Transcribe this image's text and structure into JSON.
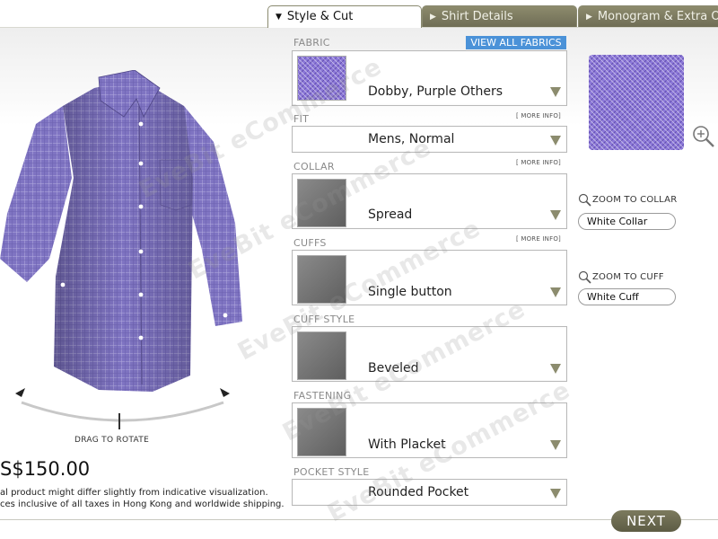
{
  "tabs": [
    {
      "label": "Style & Cut",
      "active": true
    },
    {
      "label": "Shirt Details",
      "active": false
    },
    {
      "label": "Monogram & Extra Opti",
      "active": false
    }
  ],
  "fabric": {
    "label": "FABRIC",
    "view_all": "VIEW ALL FABRICS",
    "value": "Dobby, Purple Others"
  },
  "fit": {
    "label": "FIT",
    "more_info": "[ MORE INFO]",
    "value": "Mens, Normal"
  },
  "collar": {
    "label": "COLLAR",
    "more_info": "[ MORE INFO]",
    "value": "Spread"
  },
  "cuffs": {
    "label": "CUFFS",
    "more_info": "[ MORE INFO]",
    "value": "Single button"
  },
  "cuff_style": {
    "label": "CUFF STYLE",
    "value": "Beveled"
  },
  "fastening": {
    "label": "FASTENING",
    "value": "With Placket"
  },
  "pocket_style": {
    "label": "POCKET STYLE",
    "value": "Rounded Pocket"
  },
  "zoom": {
    "collar_link": "ZOOM TO COLLAR",
    "collar_value": "White Collar",
    "cuff_link": "ZOOM TO CUFF",
    "cuff_value": "White Cuff"
  },
  "preview": {
    "drag_label": "DRAG TO ROTATE",
    "price": "S$150.00",
    "disclaimer_1": "al product might differ slightly from indicative visualization.",
    "disclaimer_2": "ces inclusive of all taxes in Hong Kong and worldwide shipping."
  },
  "next_label": "NEXT",
  "watermark": "EveBit eCommerce",
  "colors": {
    "accent": "#4b92d8",
    "tab_inactive": "#7c7a5e",
    "fabric": "#8c78d8"
  }
}
